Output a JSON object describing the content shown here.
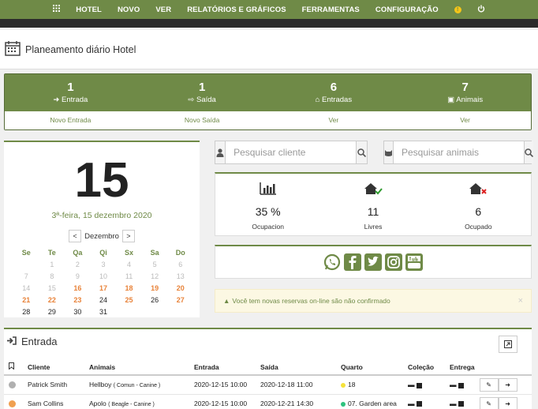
{
  "nav": {
    "items": [
      "HOTEL",
      "NOVO",
      "VER",
      "RELATÓRIOS E GRÁFICOS",
      "FERRAMENTAS",
      "CONFIGURAÇÃO"
    ]
  },
  "header": {
    "title": "Planeamento diário Hotel"
  },
  "stats": [
    {
      "count": "1",
      "label": "Entrada",
      "link": "Novo Entrada",
      "icon": "sign-in-icon"
    },
    {
      "count": "1",
      "label": "Saída",
      "link": "Novo Saída",
      "icon": "sign-out-icon"
    },
    {
      "count": "6",
      "label": "Entradas",
      "link": "Ver",
      "icon": "home-icon"
    },
    {
      "count": "7",
      "label": "Animais",
      "link": "Ver",
      "icon": "paw-icon"
    }
  ],
  "calendar": {
    "big_day": "15",
    "date_string": "3ª-feira, 15 dezembro 2020",
    "month_label": "Dezembro",
    "prev": "<",
    "next": ">",
    "weekdays": [
      "Se",
      "Te",
      "Qa",
      "Qi",
      "Sx",
      "Sa",
      "Do"
    ],
    "rows": [
      [
        [
          "",
          ""
        ],
        [
          "1",
          "muted"
        ],
        [
          "2",
          "muted"
        ],
        [
          "3",
          "muted"
        ],
        [
          "4",
          "muted"
        ],
        [
          "5",
          "muted"
        ],
        [
          "6",
          "muted"
        ]
      ],
      [
        [
          "7",
          "muted"
        ],
        [
          "8",
          "muted"
        ],
        [
          "9",
          "muted"
        ],
        [
          "10",
          "muted"
        ],
        [
          "11",
          "muted"
        ],
        [
          "12",
          "muted"
        ],
        [
          "13",
          "muted"
        ]
      ],
      [
        [
          "14",
          "muted"
        ],
        [
          "15",
          "muted"
        ],
        [
          "16",
          "orange"
        ],
        [
          "17",
          "orange"
        ],
        [
          "18",
          "orange"
        ],
        [
          "19",
          "orange"
        ],
        [
          "20",
          "orange"
        ]
      ],
      [
        [
          "21",
          "orange"
        ],
        [
          "22",
          "orange"
        ],
        [
          "23",
          "orange"
        ],
        [
          "24",
          "norm"
        ],
        [
          "25",
          "orange"
        ],
        [
          "26",
          "norm"
        ],
        [
          "27",
          "orange"
        ]
      ],
      [
        [
          "28",
          "norm"
        ],
        [
          "29",
          "norm"
        ],
        [
          "30",
          "norm"
        ],
        [
          "31",
          "norm"
        ],
        [
          "",
          ""
        ],
        [
          "",
          ""
        ],
        [
          "",
          ""
        ]
      ]
    ]
  },
  "search_client": {
    "placeholder": "Pesquisar cliente"
  },
  "search_animal": {
    "placeholder": "Pesquisar animais"
  },
  "occupancy": [
    {
      "value": "35 %",
      "label": "Ocupacion",
      "icon": "bar-chart-icon"
    },
    {
      "value": "11",
      "label": "Livres",
      "icon": "home-check-icon"
    },
    {
      "value": "6",
      "label": "Ocupado",
      "icon": "home-x-icon"
    }
  ],
  "alert": {
    "text": "Você tem novas reservas on-line são não confirmado",
    "close": "×"
  },
  "entrada": {
    "title": "Entrada",
    "columns": [
      "Cliente",
      "Animais",
      "Entrada",
      "Saída",
      "Quarto",
      "Coleção",
      "Entrega"
    ],
    "rows": [
      {
        "dot_color": "#b0b0b0",
        "client": "Patrick Smith",
        "animal": "Hellboy",
        "animal_sub": "( Comun - Canine )",
        "in": "2020-12-15 10:00",
        "out": "2020-12-18 11:00",
        "room_color": "#f5e23a",
        "room": "18"
      },
      {
        "dot_color": "#f0a050",
        "client": "Sam Collins",
        "animal": "Apolo",
        "animal_sub": "( Beagle - Canine )",
        "in": "2020-12-15 10:00",
        "out": "2020-12-21 14:30",
        "room_color": "#2ec27e",
        "room": "07. Garden area"
      }
    ]
  },
  "colors": {
    "accent": "#6f8a47",
    "orange": "#e8833a"
  }
}
